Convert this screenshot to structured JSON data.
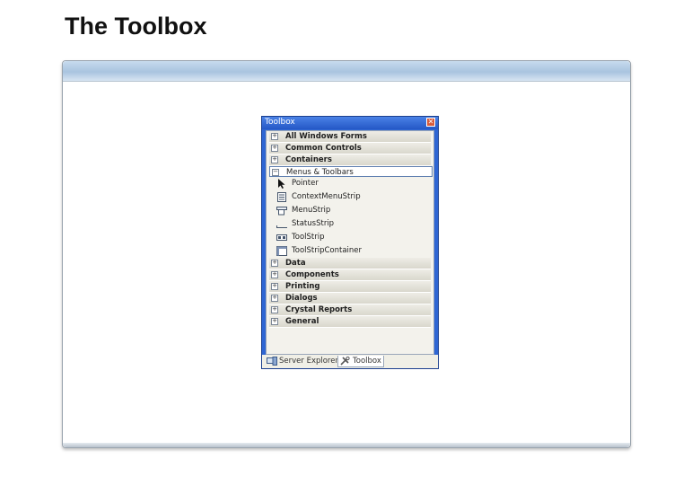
{
  "slide": {
    "title": "The Toolbox"
  },
  "toolbox": {
    "title": "Toolbox",
    "close_glyph": "✕",
    "categories_top": [
      {
        "label": "All Windows Forms",
        "glyph": "+"
      },
      {
        "label": "Common Controls",
        "glyph": "+"
      },
      {
        "label": "Containers",
        "glyph": "+"
      }
    ],
    "open_category": {
      "label": "Menus & Toolbars",
      "glyph": "−"
    },
    "items": [
      {
        "label": "Pointer",
        "icon": "pointer-icon"
      },
      {
        "label": "ContextMenuStrip",
        "icon": "context-menu-strip-icon"
      },
      {
        "label": "MenuStrip",
        "icon": "menu-strip-icon"
      },
      {
        "label": "StatusStrip",
        "icon": "status-strip-icon"
      },
      {
        "label": "ToolStrip",
        "icon": "tool-strip-icon"
      },
      {
        "label": "ToolStripContainer",
        "icon": "tool-strip-container-icon"
      }
    ],
    "categories_bottom": [
      {
        "label": "Data",
        "glyph": "+"
      },
      {
        "label": "Components",
        "glyph": "+"
      },
      {
        "label": "Printing",
        "glyph": "+"
      },
      {
        "label": "Dialogs",
        "glyph": "+"
      },
      {
        "label": "Crystal Reports",
        "glyph": "+"
      },
      {
        "label": "General",
        "glyph": "+"
      }
    ],
    "tabs": [
      {
        "label": "Server Explorer",
        "icon": "server-explorer-icon",
        "active": false
      },
      {
        "label": "Toolbox",
        "icon": "toolbox-icon",
        "active": true
      }
    ]
  },
  "colors": {
    "titlebar": "#2457c6",
    "window_border": "#2f66d3",
    "panel_bg": "#f3f2ec",
    "selection_border": "#5f7fb0"
  }
}
